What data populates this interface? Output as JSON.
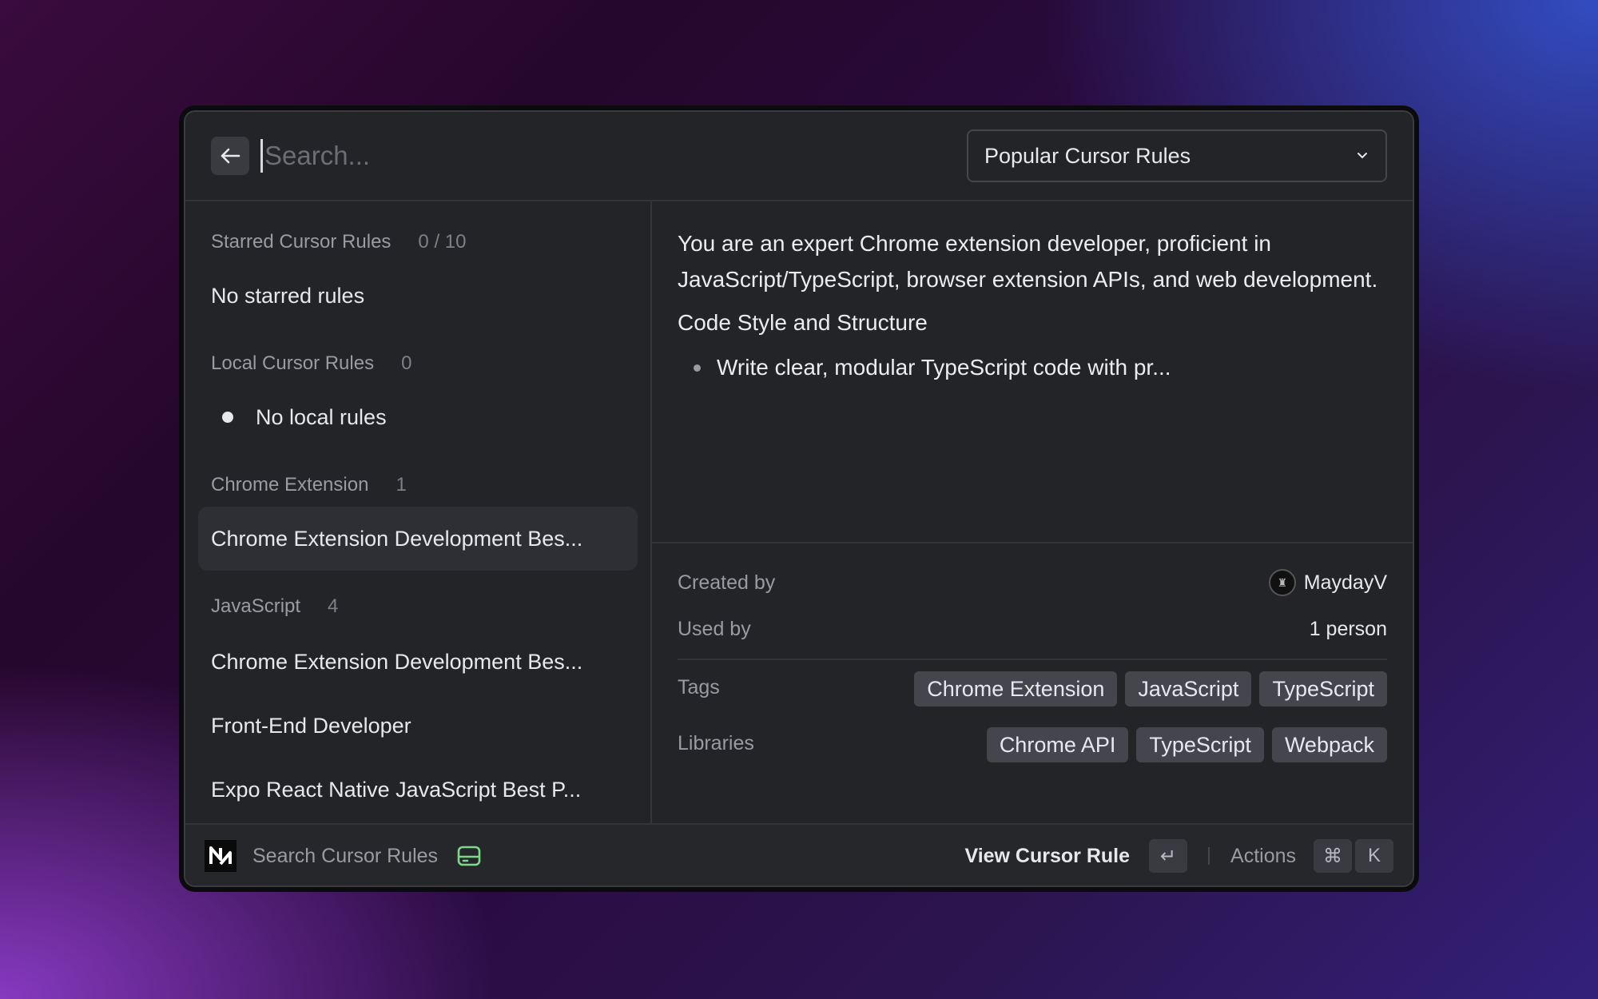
{
  "search": {
    "placeholder": "Search..."
  },
  "dropdown": {
    "selected": "Popular Cursor Rules"
  },
  "sidebar": {
    "starred": {
      "title": "Starred Cursor Rules",
      "count": "0 / 10",
      "empty": "No starred rules"
    },
    "local": {
      "title": "Local Cursor Rules",
      "count": "0",
      "empty": "No local rules"
    },
    "chrome": {
      "title": "Chrome Extension",
      "count": "1",
      "items": [
        "Chrome Extension Development Bes..."
      ]
    },
    "javascript": {
      "title": "JavaScript",
      "count": "4",
      "items": [
        "Chrome Extension Development Bes...",
        "Front-End Developer",
        "Expo React Native JavaScript Best P..."
      ]
    }
  },
  "detail": {
    "paragraph": "You are an expert Chrome extension developer, proficient in JavaScript/TypeScript, browser extension APIs, and web development.",
    "heading": "Code Style and Structure",
    "bullet": "Write clear, modular TypeScript code with pr..."
  },
  "meta": {
    "created_label": "Created by",
    "creator": "MaydayV",
    "used_label": "Used by",
    "used_value": "1 person",
    "tags_label": "Tags",
    "tags": [
      "Chrome Extension",
      "JavaScript",
      "TypeScript"
    ],
    "libraries_label": "Libraries",
    "libraries": [
      "Chrome API",
      "TypeScript",
      "Webpack"
    ]
  },
  "footer": {
    "title": "Search Cursor Rules",
    "primary_action": "View Cursor Rule",
    "enter_key": "↵",
    "actions_label": "Actions",
    "cmd_key": "⌘",
    "k_key": "K"
  },
  "colors": {
    "accent_green": "#7ed88a",
    "window_bg": "#232428"
  },
  "icons": {
    "back": "arrow-left-icon",
    "chevron": "chevron-down-icon",
    "db": "database-icon",
    "logo": "raycast-n-logo"
  }
}
